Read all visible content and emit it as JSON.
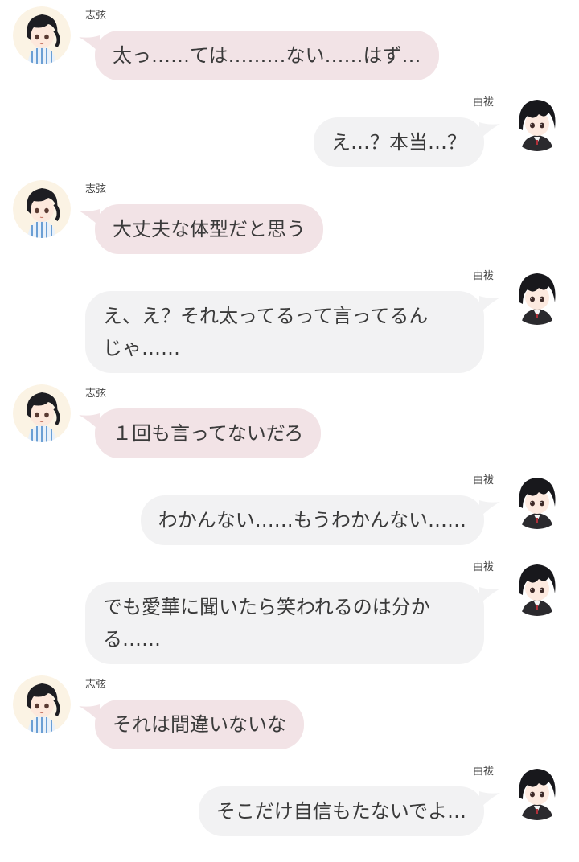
{
  "characters": {
    "shigen": {
      "name": "志弦",
      "avatar_icon": "shigen-avatar-icon"
    },
    "yui": {
      "name": "由祓",
      "avatar_icon": "yui-avatar-icon"
    }
  },
  "colors": {
    "left_bubble": "#f2e3e6",
    "right_bubble": "#f2f2f3",
    "text": "#3a3a3a"
  },
  "messages": [
    {
      "speaker": "志弦",
      "side": "left",
      "text": "太っ……ては………ない……はず…"
    },
    {
      "speaker": "由祓",
      "side": "right",
      "text": "え…？本当…？"
    },
    {
      "speaker": "志弦",
      "side": "left",
      "text": "大丈夫な体型だと思う"
    },
    {
      "speaker": "由祓",
      "side": "right",
      "lines": [
        "え、え？それ太ってるって言ってるん",
        "じゃ……"
      ]
    },
    {
      "speaker": "志弦",
      "side": "left",
      "text": "１回も言ってないだろ"
    },
    {
      "speaker": "由祓",
      "side": "right",
      "text": "わかんない……もうわかんない……"
    },
    {
      "speaker": "由祓",
      "side": "right",
      "lines": [
        "でも愛華に聞いたら笑われるのは分か",
        "る……"
      ]
    },
    {
      "speaker": "志弦",
      "side": "left",
      "text": "それは間違いないな"
    },
    {
      "speaker": "由祓",
      "side": "right",
      "text": "そこだけ自信もたないでよ…"
    }
  ]
}
